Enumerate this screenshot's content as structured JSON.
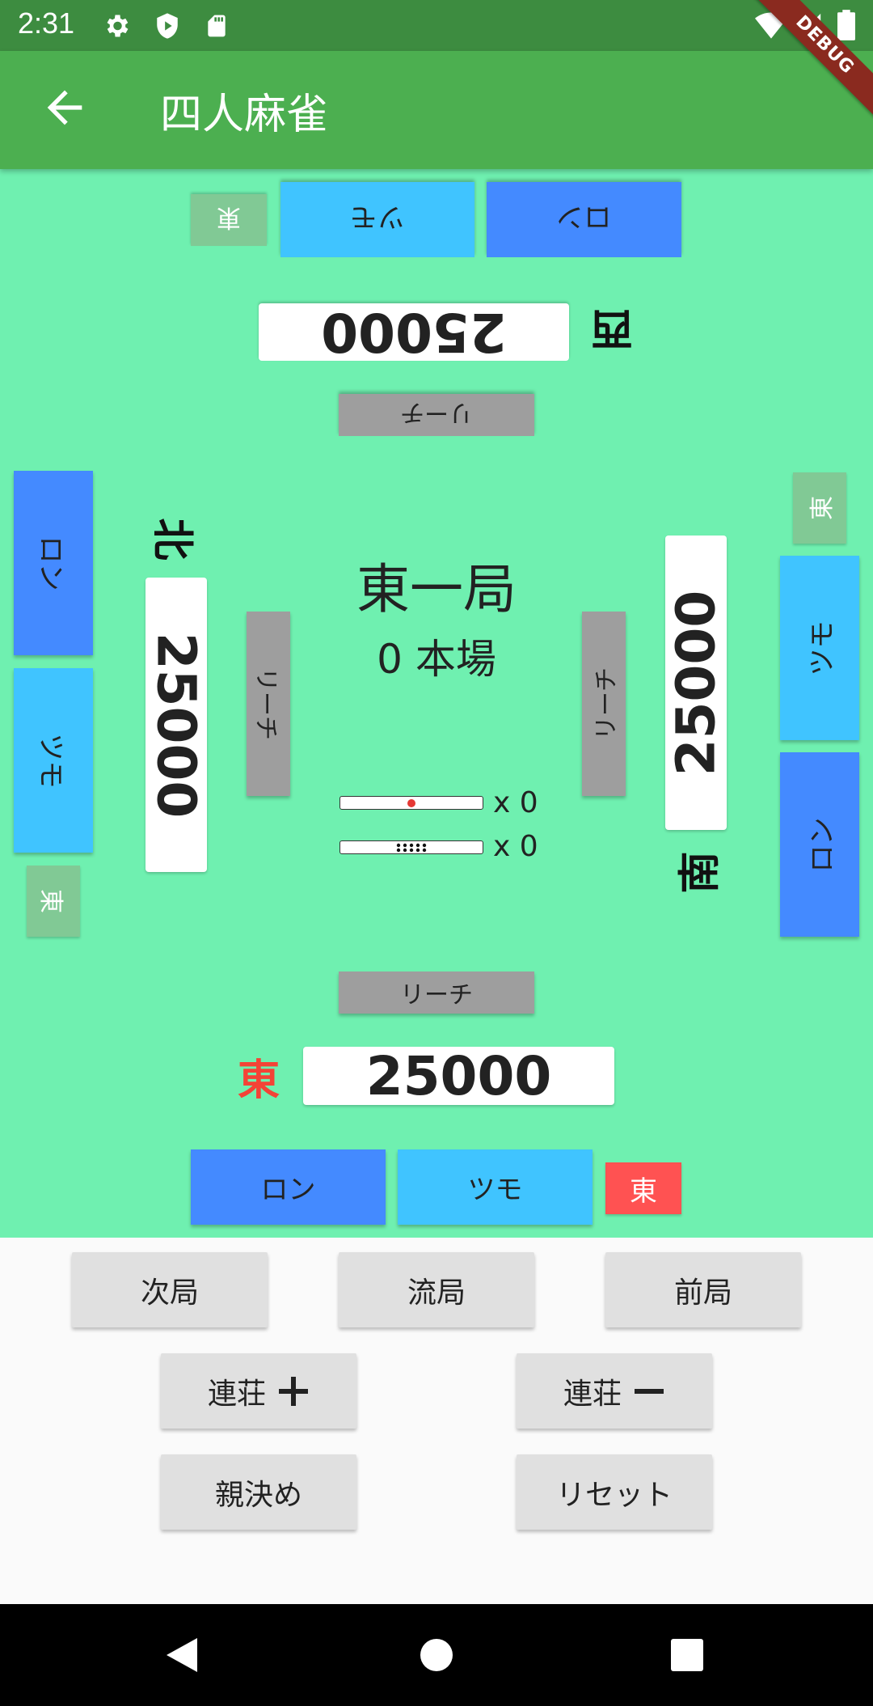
{
  "status_bar": {
    "time": "2:31",
    "icons": [
      "gear-icon",
      "play-protect-icon",
      "sd-card-icon",
      "wifi-icon",
      "signal-icon",
      "battery-icon"
    ],
    "debug_banner": "DEBUG"
  },
  "app_bar": {
    "title": "四人麻雀",
    "back_icon": "arrow-left-icon"
  },
  "table": {
    "round": "東一局",
    "honba": "0 本場",
    "riichi_sticks": "x 0",
    "honba_sticks": "x 0",
    "players": {
      "bottom": {
        "wind": "東",
        "score": "25000",
        "seat": "東",
        "ron": "ロン",
        "tsumo": "ツモ",
        "riichi": "リーチ",
        "dealer": true
      },
      "right": {
        "wind": "南",
        "score": "25000",
        "seat": "東",
        "ron": "ロン",
        "tsumo": "ツモ",
        "riichi": "リーチ"
      },
      "top": {
        "wind": "西",
        "score": "25000",
        "seat": "東",
        "ron": "ロン",
        "tsumo": "ツモ",
        "riichi": "リーチ"
      },
      "left": {
        "wind": "北",
        "score": "25000",
        "seat": "東",
        "ron": "ロン",
        "tsumo": "ツモ",
        "riichi": "リーチ"
      }
    }
  },
  "controls": {
    "next_round": "次局",
    "draw": "流局",
    "prev_round": "前局",
    "renchan_plus": "連荘",
    "renchan_minus": "連荘",
    "decide_dealer": "親決め",
    "reset": "リセット"
  },
  "colors": {
    "status_bar": "#3d8c40",
    "app_bar": "#4caf50",
    "table": "#6ff0b0",
    "ron": "#448aff",
    "tsumo": "#40c4ff",
    "dealer_red": "#ff5252",
    "wind_east_red": "#f44336"
  }
}
